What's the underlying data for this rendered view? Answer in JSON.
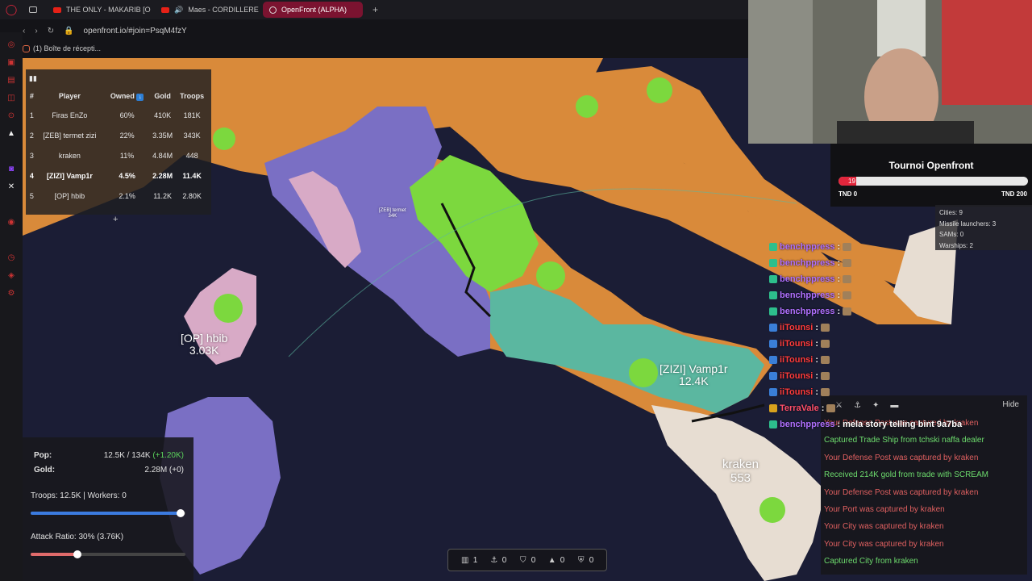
{
  "browser": {
    "tabs": [
      {
        "label": "THE ONLY - MAKARIB [O",
        "type": "youtube"
      },
      {
        "label": "Maes - CORDILLERE",
        "type": "youtube"
      },
      {
        "label": "OpenFront (ALPHA)",
        "type": "site",
        "active": true
      }
    ],
    "new_tab": "+",
    "url": "openfront.io/#join=PsqM4fzY",
    "bookmark": "(1) Boîte de récepti..."
  },
  "leaderboard": {
    "headers": [
      "#",
      "Player",
      "Owned",
      "Gold",
      "Troops"
    ],
    "sort_icon": "↓",
    "rows": [
      {
        "rank": "1",
        "player": "Firas EnZo",
        "owned": "60%",
        "gold": "410K",
        "troops": "181K"
      },
      {
        "rank": "2",
        "player": "[ZEB] termet zizi",
        "owned": "22%",
        "gold": "3.35M",
        "troops": "343K"
      },
      {
        "rank": "3",
        "player": "kraken",
        "owned": "11%",
        "gold": "4.84M",
        "troops": "448"
      },
      {
        "rank": "4",
        "player": "[ZIZI] Vamp1r",
        "owned": "4.5%",
        "gold": "2.28M",
        "troops": "11.4K",
        "me": true
      },
      {
        "rank": "5",
        "player": "[OP] hbib",
        "owned": "2.1%",
        "gold": "11.2K",
        "troops": "2.80K"
      }
    ],
    "expand": "+"
  },
  "tournament": {
    "title": "Tournoi Openfront",
    "value": "19",
    "progress": 0.095,
    "min_label": "TND 0",
    "max_label": "TND 200"
  },
  "player_stats": {
    "lines": [
      "Cities: 9",
      "Missile launchers: 3",
      "SAMs: 0",
      "Warships: 2"
    ]
  },
  "chat": [
    {
      "user": "benchppress",
      "color": "#b070ff",
      "badge": "#2dbf8c",
      "msg": ""
    },
    {
      "user": "benchppress",
      "color": "#b070ff",
      "badge": "#2dbf8c",
      "msg": ""
    },
    {
      "user": "benchppress",
      "color": "#b070ff",
      "badge": "#2dbf8c",
      "msg": ""
    },
    {
      "user": "benchppress",
      "color": "#b070ff",
      "badge": "#2dbf8c",
      "msg": ""
    },
    {
      "user": "benchppress",
      "color": "#b070ff",
      "badge": "#2dbf8c",
      "msg": ""
    },
    {
      "user": "iiTounsi",
      "color": "#ff3b3b",
      "badge": "#3a7fd8",
      "msg": ""
    },
    {
      "user": "iiTounsi",
      "color": "#ff3b3b",
      "badge": "#3a7fd8",
      "msg": ""
    },
    {
      "user": "iiTounsi",
      "color": "#ff3b3b",
      "badge": "#3a7fd8",
      "msg": ""
    },
    {
      "user": "iiTounsi",
      "color": "#ff3b3b",
      "badge": "#3a7fd8",
      "msg": ""
    },
    {
      "user": "iiTounsi",
      "color": "#ff3b3b",
      "badge": "#3a7fd8",
      "msg": ""
    },
    {
      "user": "TerraVale",
      "color": "#ff4f6a",
      "badge": "#d9a21d",
      "msg": ""
    },
    {
      "user": "benchppress",
      "color": "#b070ff",
      "badge": "#2dbf8c",
      "msg": "mela story telling bint 9a7ba"
    }
  ],
  "events": {
    "hide_label": "Hide",
    "items": [
      {
        "text": "Your Defense Post was captured by kraken",
        "kind": "red"
      },
      {
        "text": "Captured Trade Ship from tchski naffa dealer",
        "kind": "green"
      },
      {
        "text": "Your Defense Post was captured by kraken",
        "kind": "red"
      },
      {
        "text": "Received 214K gold from trade with SCREAM",
        "kind": "green"
      },
      {
        "text": "Your Defense Post was captured by kraken",
        "kind": "red"
      },
      {
        "text": "Your Port was captured by kraken",
        "kind": "red"
      },
      {
        "text": "Your City was captured by kraken",
        "kind": "red"
      },
      {
        "text": "Your City was captured by kraken",
        "kind": "red"
      },
      {
        "text": "Captured City from kraken",
        "kind": "green"
      }
    ]
  },
  "control": {
    "pop_label": "Pop:",
    "pop_value": "12.5K / 134K",
    "pop_delta": "(+1.20K)",
    "gold_label": "Gold:",
    "gold_value": "2.28M (+0)",
    "troops_workers": "Troops: 12.5K | Workers: 0",
    "troop_ratio": 0.97,
    "attack_ratio_label": "Attack Ratio: 30% (3.76K)",
    "attack_ratio": 0.3
  },
  "buildbar": [
    {
      "icon": "city-icon",
      "count": "1"
    },
    {
      "icon": "anchor-icon",
      "count": "0"
    },
    {
      "icon": "shield-icon",
      "count": "0"
    },
    {
      "icon": "missile-icon",
      "count": "0"
    },
    {
      "icon": "sam-icon",
      "count": "0"
    }
  ],
  "map_labels": [
    {
      "name": "[OP] hbib",
      "troops": "3.03K"
    },
    {
      "name": "[ZIZI] Vamp1r",
      "troops": "12.4K"
    },
    {
      "name": "kraken",
      "troops": "553"
    },
    {
      "name": "[ZEB] termet",
      "troops": "34K"
    }
  ],
  "colors": {
    "sea": "#1a1c33",
    "orange": "#d98a3a",
    "purple": "#7a6fc4",
    "pink": "#d8aac6",
    "green": "#7cd83e",
    "teal": "#5bb7a0",
    "beige": "#e7ddd2"
  }
}
